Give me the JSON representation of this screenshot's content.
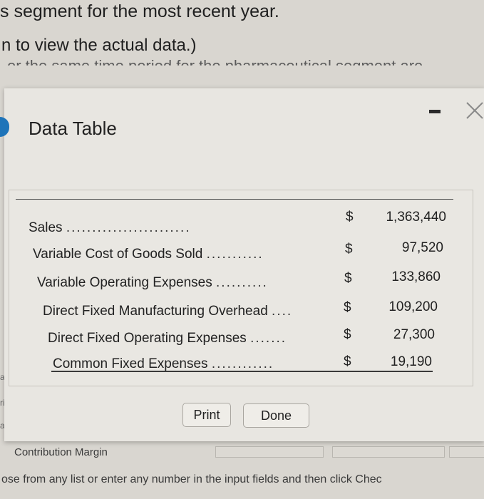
{
  "background": {
    "line1": "s segment for the most recent year.",
    "line2": "n to view the actual data.)",
    "line3": "or the same time period for the pharmaceutical segment are",
    "side1": "aria",
    "side2": "riab",
    "side3": "ariab",
    "bottom_label": "Contribution Margin",
    "bottom_text": "ose from any list or enter any number in the input fields and then click Chec"
  },
  "modal": {
    "title": "Data Table",
    "print_label": "Print",
    "done_label": "Done"
  },
  "table": {
    "rows": [
      {
        "label": "Sales",
        "dots": "........................",
        "currency": "$",
        "amount": "1,363,440"
      },
      {
        "label": "Variable Cost of Goods Sold",
        "dots": "...........",
        "currency": "$",
        "amount": "97,520"
      },
      {
        "label": "Variable Operating Expenses",
        "dots": "..........",
        "currency": "$",
        "amount": "133,860"
      },
      {
        "label": "Direct Fixed Manufacturing Overhead",
        "dots": "....",
        "currency": "$",
        "amount": "109,200"
      },
      {
        "label": "Direct Fixed Operating Expenses",
        "dots": ".......",
        "currency": "$",
        "amount": "27,300"
      },
      {
        "label": "Common Fixed Expenses",
        "dots": "............",
        "currency": "$",
        "amount": "19,190"
      }
    ]
  },
  "colors": {
    "accent": "#1e74b9",
    "modal_bg": "#e8e6e1",
    "page_bg": "#d9d6d0"
  }
}
